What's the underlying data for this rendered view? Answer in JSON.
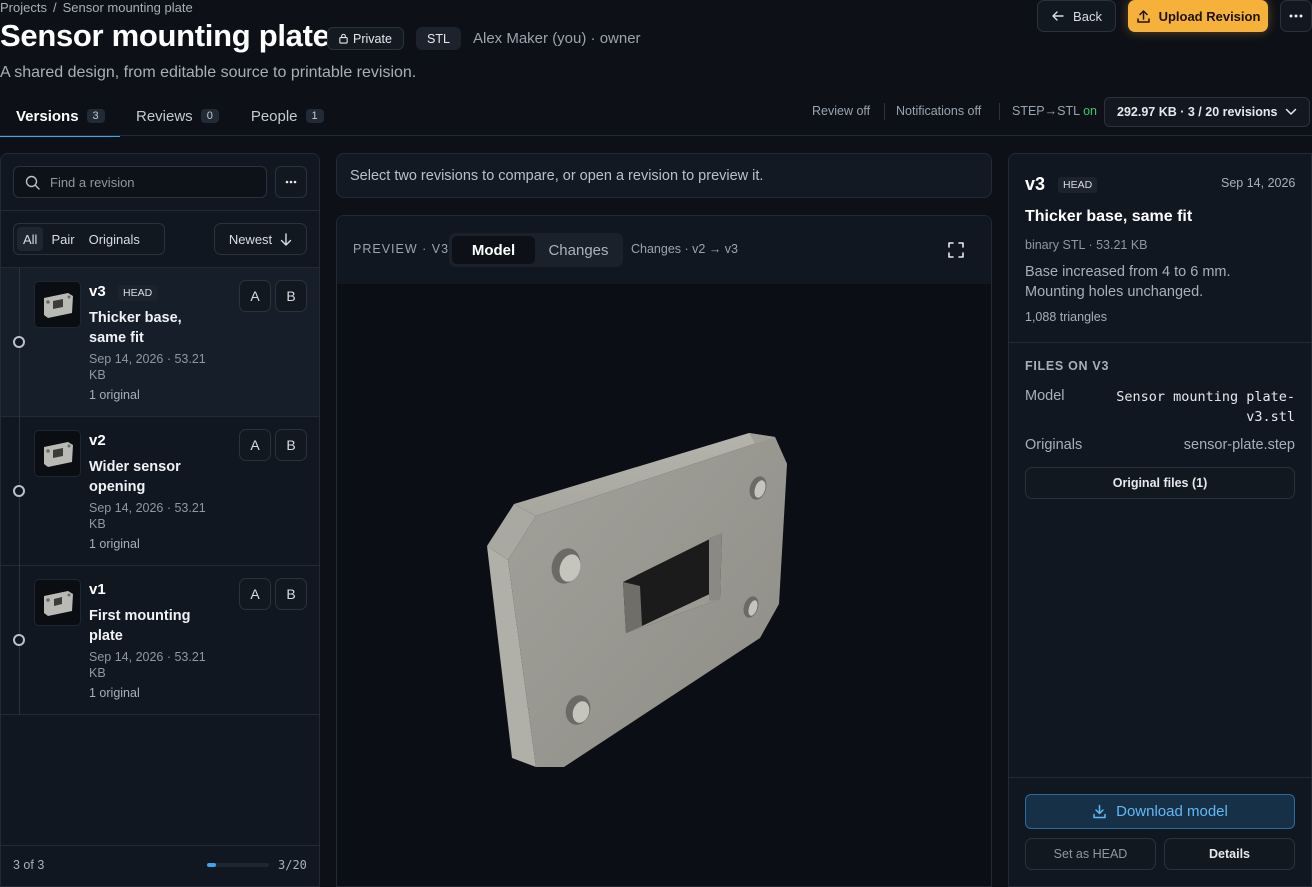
{
  "breadcrumb": {
    "root": "Projects",
    "separator": "/",
    "current": "Sensor mounting plate"
  },
  "header": {
    "title": "Sensor mounting plate",
    "visibility": "Private",
    "format": "STL",
    "owner": "Alex Maker (you) · owner",
    "subtitle": "A shared design, from editable source to printable revision.",
    "back_label": "Back",
    "upload_label": "Upload Revision"
  },
  "tabs": [
    {
      "label": "Versions",
      "count": "3",
      "active": true
    },
    {
      "label": "Reviews",
      "count": "0"
    },
    {
      "label": "People",
      "count": "1"
    }
  ],
  "status": {
    "review": "Review off",
    "notifications": "Notifications off",
    "conversion_prefix": "STEP→STL",
    "conversion_state": "on",
    "storage": "292.97 KB · 3 / 20 revisions"
  },
  "left_panel": {
    "search_placeholder": "Find a revision",
    "filters": [
      "All",
      "Pair",
      "Originals"
    ],
    "sort_label": "Newest",
    "revisions": [
      {
        "name": "v3",
        "badge": "HEAD",
        "title": "Thicker base, same fit",
        "meta": "Sep 14, 2026 · 53.21 KB",
        "originals": "1 original",
        "a": "A",
        "b": "B"
      },
      {
        "name": "v2",
        "badge": "",
        "title": "Wider sensor opening",
        "meta": "Sep 14, 2026 · 53.21 KB",
        "originals": "1 original",
        "a": "A",
        "b": "B"
      },
      {
        "name": "v1",
        "badge": "",
        "title": "First mounting plate",
        "meta": "Sep 14, 2026 · 53.21 KB",
        "originals": "1 original",
        "a": "A",
        "b": "B"
      }
    ],
    "footer_count": "3 of 3",
    "quota_text": "3/20",
    "quota_fraction": 0.15
  },
  "middle": {
    "hint": "Select two revisions to compare, or open a revision to preview it.",
    "preview_label": "PREVIEW · V3",
    "view_modes": [
      "Model",
      "Changes"
    ],
    "changes_label": "Changes · v2 → v3"
  },
  "right_panel": {
    "version": "v3",
    "badge": "HEAD",
    "date": "Sep 14, 2026",
    "title": "Thicker base, same fit",
    "meta": "binary STL · 53.21 KB",
    "description": "Base increased from 4 to 6 mm. Mounting holes unchanged.",
    "triangles": "1,088 triangles",
    "files_heading": "FILES ON V3",
    "model_key": "Model",
    "model_value": "Sensor mounting plate-v3.stl",
    "originals_key": "Originals",
    "originals_value": "sensor-plate.step",
    "original_files_button": "Original files (1)",
    "download_label": "Download model",
    "set_head_label": "Set as HEAD",
    "details_label": "Details"
  },
  "colors": {
    "accent": "#3ba3f0",
    "upload": "#f5b13a",
    "status_on": "#3fc46b",
    "background": "#0d1117"
  }
}
